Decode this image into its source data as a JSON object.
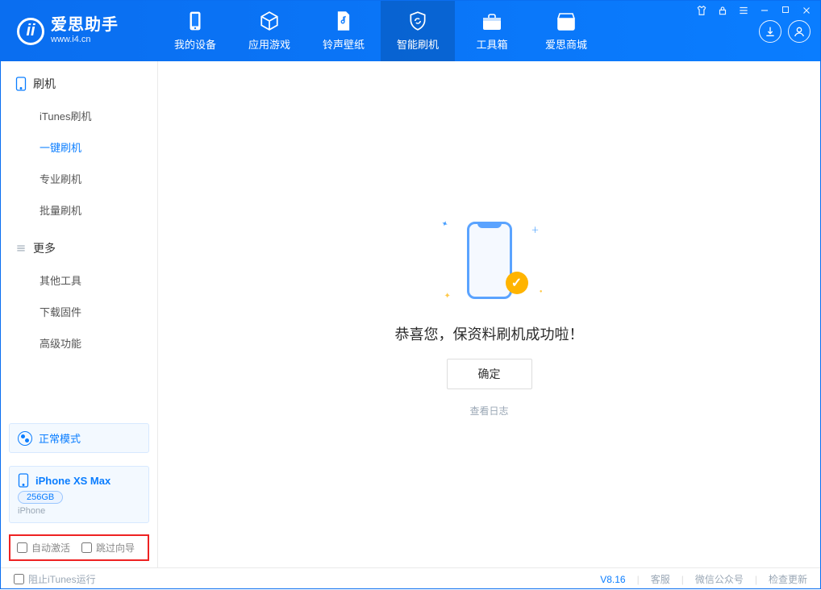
{
  "app": {
    "title": "爱思助手",
    "subtitle": "www.i4.cn"
  },
  "tabs": [
    {
      "label": "我的设备"
    },
    {
      "label": "应用游戏"
    },
    {
      "label": "铃声壁纸"
    },
    {
      "label": "智能刷机"
    },
    {
      "label": "工具箱"
    },
    {
      "label": "爱思商城"
    }
  ],
  "sidebar": {
    "section1": {
      "title": "刷机",
      "items": [
        "iTunes刷机",
        "一键刷机",
        "专业刷机",
        "批量刷机"
      ]
    },
    "section2": {
      "title": "更多",
      "items": [
        "其他工具",
        "下载固件",
        "高级功能"
      ]
    }
  },
  "mode": {
    "label": "正常模式"
  },
  "device": {
    "name": "iPhone XS Max",
    "storage": "256GB",
    "type": "iPhone"
  },
  "options": {
    "auto_activate": "自动激活",
    "skip_guide": "跳过向导"
  },
  "main": {
    "success": "恭喜您，保资料刷机成功啦！",
    "ok": "确定",
    "view_log": "查看日志"
  },
  "footer": {
    "block_itunes": "阻止iTunes运行",
    "version": "V8.16",
    "links": [
      "客服",
      "微信公众号",
      "检查更新"
    ]
  }
}
